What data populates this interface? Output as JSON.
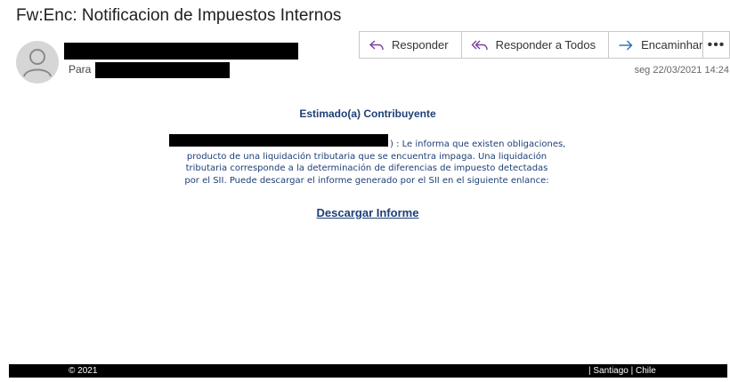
{
  "email": {
    "subject": "Fw:Enc: Notificacion de Impuestos Internos",
    "to_label": "Para",
    "date": "seg 22/03/2021 14:24"
  },
  "toolbar": {
    "reply_label": "Responder",
    "reply_all_label": "Responder a Todos",
    "forward_label": "Encaminhar",
    "more_label": "•••"
  },
  "body": {
    "greeting": "Estimado(a) Contribuyente",
    "line1": ") : Le informa que existen obligaciones,",
    "line2": "producto de una liquidación tributaria que se encuentra impaga. Una liquidación",
    "line3": "tributaria corresponde a la determinación de diferencias de impuesto detectadas",
    "line4": "por el SII.   Puede descargar el informe generado por el SII en el siguiente enlance:",
    "download_link": "Descargar Informe"
  },
  "footer": {
    "copyright": "© 2021",
    "location": "| Santiago | Chile"
  },
  "icons": {
    "avatar": "person-icon",
    "reply": "reply-arrow-icon",
    "reply_all": "reply-all-arrow-icon",
    "forward": "forward-arrow-icon",
    "more": "ellipsis-icon"
  },
  "colors": {
    "body_text": "#1d3f77",
    "reply_icon": "#7a3ea0",
    "forward_icon": "#2b6cb0",
    "redaction": "#000000"
  }
}
